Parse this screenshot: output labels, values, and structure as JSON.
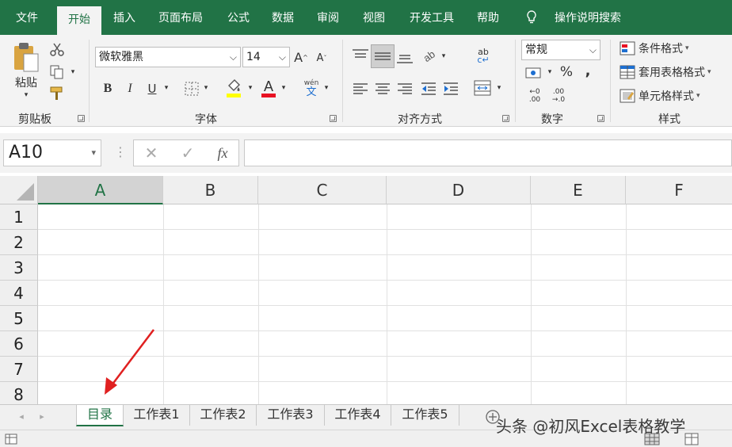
{
  "ribbon_tabs": [
    "文件",
    "开始",
    "插入",
    "页面布局",
    "公式",
    "数据",
    "审阅",
    "视图",
    "开发工具",
    "帮助"
  ],
  "active_tab": "开始",
  "tell_me": "操作说明搜索",
  "clipboard": {
    "paste": "粘贴",
    "group": "剪贴板"
  },
  "font": {
    "name": "微软雅黑",
    "size": "14",
    "group": "字体",
    "bold": "B",
    "italic": "I",
    "underline": "U",
    "grow": "A",
    "shrink": "A",
    "wen": "wén",
    "wen_char": "文"
  },
  "alignment": {
    "group": "对齐方式"
  },
  "number": {
    "format": "常规",
    "percent": "%",
    "comma": ",",
    "group": "数字",
    "inc": "←0 .00",
    "dec": ".00 →.0"
  },
  "styles": {
    "conditional": "条件格式",
    "table": "套用表格格式",
    "cell": "单元格样式",
    "group": "样式"
  },
  "formula_bar": {
    "name_box": "A10",
    "cancel": "✕",
    "enter": "✓",
    "fx": "fx",
    "value": ""
  },
  "columns": [
    "A",
    "B",
    "C",
    "D",
    "E",
    "F"
  ],
  "rows": [
    "1",
    "2",
    "3",
    "4",
    "5",
    "6",
    "7",
    "8"
  ],
  "sheets": [
    "目录",
    "工作表1",
    "工作表2",
    "工作表3",
    "工作表4",
    "工作表5"
  ],
  "active_sheet": "目录",
  "watermark": "头条 @初风Excel表格教学",
  "colors": {
    "brand": "#217346",
    "annotation_arrow": "#e02020"
  }
}
